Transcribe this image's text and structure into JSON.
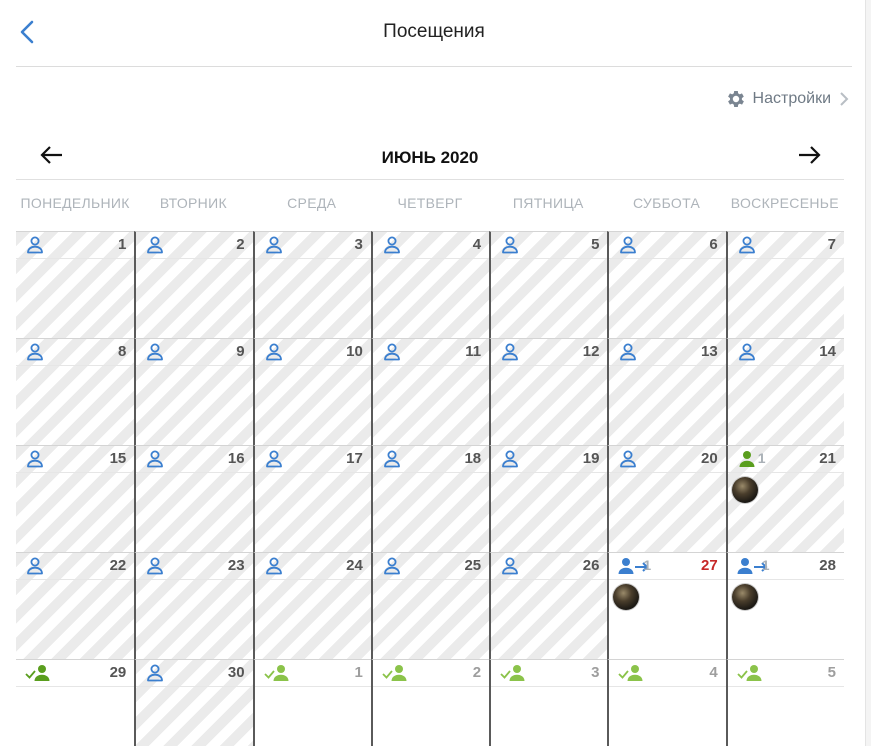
{
  "header": {
    "title": "Посещения"
  },
  "settings": {
    "label": "Настройки"
  },
  "calendar": {
    "month_title": "ИЮНЬ 2020",
    "weekdays": [
      "ПОНЕДЕЛЬНИК",
      "ВТОРНИК",
      "СРЕДА",
      "ЧЕТВЕРГ",
      "ПЯТНИЦА",
      "СУББОТА",
      "ВОСКРЕСЕНЬЕ"
    ],
    "days": [
      {
        "day": "1"
      },
      {
        "day": "2"
      },
      {
        "day": "3"
      },
      {
        "day": "4"
      },
      {
        "day": "5"
      },
      {
        "day": "6"
      },
      {
        "day": "7"
      },
      {
        "day": "8"
      },
      {
        "day": "9"
      },
      {
        "day": "10"
      },
      {
        "day": "11"
      },
      {
        "day": "12"
      },
      {
        "day": "13"
      },
      {
        "day": "14"
      },
      {
        "day": "15"
      },
      {
        "day": "16"
      },
      {
        "day": "17"
      },
      {
        "day": "18"
      },
      {
        "day": "19"
      },
      {
        "day": "20"
      },
      {
        "day": "21",
        "count": "1"
      },
      {
        "day": "22"
      },
      {
        "day": "23"
      },
      {
        "day": "24"
      },
      {
        "day": "25"
      },
      {
        "day": "26"
      },
      {
        "day": "27",
        "count": "1"
      },
      {
        "day": "28",
        "count": "1"
      },
      {
        "day": "29"
      },
      {
        "day": "30"
      },
      {
        "day": "1"
      },
      {
        "day": "2"
      },
      {
        "day": "3"
      },
      {
        "day": "4"
      },
      {
        "day": "5"
      }
    ]
  },
  "colors": {
    "accent_blue": "#3b7fcf",
    "visit_green": "#5a9e1e",
    "visit_green_light": "#8bc34a",
    "today_red": "#c62828"
  },
  "icons": {
    "back": "chevron-left-icon",
    "settings": "gear-icon",
    "settings_chevron": "chevron-right-icon",
    "prev": "arrow-left-icon",
    "next": "arrow-right-icon",
    "empty_day": "user-outline-icon",
    "visited_day": "user-filled-icon",
    "checked_day": "user-check-icon",
    "planned_day": "user-arrow-icon"
  }
}
